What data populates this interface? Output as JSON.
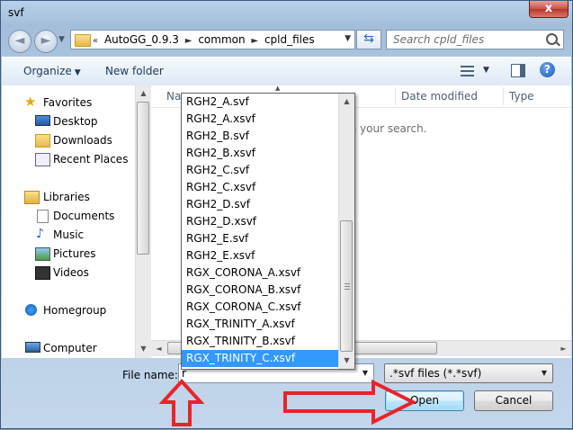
{
  "window": {
    "title": "svf",
    "close_label": "x"
  },
  "navbar": {
    "back": "◄",
    "forward": "►",
    "recent": "▼",
    "breadcrumbs": [
      "«",
      "AutoGG_0.9.3",
      "►",
      "common",
      "►",
      "cpld_files"
    ],
    "address_dropdown": "▼",
    "refresh": "⇆",
    "search_placeholder": "Search cpld_files"
  },
  "toolbar": {
    "organize": "Organize",
    "organize_caret": "▼",
    "new_folder": "New folder",
    "view_caret": "▼",
    "help": "?"
  },
  "nav_pane": {
    "items": [
      {
        "label": "Favorites",
        "icon": "star-icon"
      },
      {
        "label": "Desktop",
        "icon": "desktop-icon"
      },
      {
        "label": "Downloads",
        "icon": "downloads-icon"
      },
      {
        "label": "Recent Places",
        "icon": "recent-places-icon"
      },
      {
        "label": "Libraries",
        "icon": "libraries-icon"
      },
      {
        "label": "Documents",
        "icon": "documents-icon"
      },
      {
        "label": "Music",
        "icon": "music-icon"
      },
      {
        "label": "Pictures",
        "icon": "pictures-icon"
      },
      {
        "label": "Videos",
        "icon": "videos-icon"
      },
      {
        "label": "Homegroup",
        "icon": "homegroup-icon"
      },
      {
        "label": "Computer",
        "icon": "computer-icon"
      }
    ]
  },
  "file_list": {
    "columns": [
      "Na",
      "Date modified",
      "Type"
    ],
    "empty_message": "ch your search.",
    "sort_caret": "▲"
  },
  "scroll": {
    "up": "▲",
    "down": "▼",
    "left": "◄",
    "right": "►"
  },
  "file_name": {
    "label": "File name:",
    "value": "r",
    "arrow": "▼"
  },
  "file_type": {
    "value": ".*svf files (*.*svf)",
    "arrow": "▼"
  },
  "buttons": {
    "open": "Open",
    "cancel": "Cancel"
  },
  "autocomplete": {
    "items": [
      "RGH2_A.svf",
      "RGH2_A.xsvf",
      "RGH2_B.svf",
      "RGH2_B.xsvf",
      "RGH2_C.svf",
      "RGH2_C.xsvf",
      "RGH2_D.svf",
      "RGH2_D.xsvf",
      "RGH2_E.svf",
      "RGH2_E.xsvf",
      "RGX_CORONA_A.xsvf",
      "RGX_CORONA_B.xsvf",
      "RGX_CORONA_C.xsvf",
      "RGX_TRINITY_A.xsvf",
      "RGX_TRINITY_B.xsvf",
      "RGX_TRINITY_C.xsvf"
    ],
    "selected_index": 15
  },
  "annotations": {
    "color": "#e8242a"
  }
}
